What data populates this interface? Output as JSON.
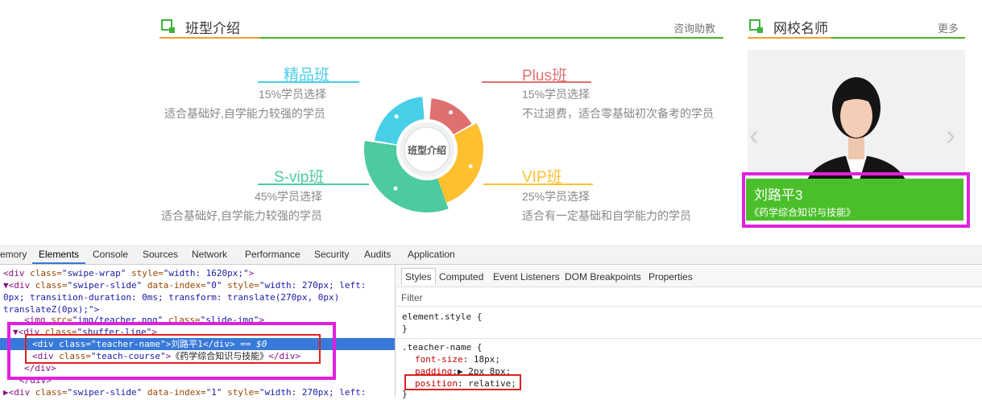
{
  "page": {
    "class_section": {
      "title": "班型介绍",
      "more": "咨询助教",
      "pie_center": "班型介绍",
      "classes": [
        {
          "name": "精品班",
          "ratio": "15%学员选择",
          "desc": "适合基础好,自学能力较强的学员",
          "color": "#48cfe8"
        },
        {
          "name": "Plus班",
          "ratio": "15%学员选择",
          "desc": "不过退费，适合零基础初次备考的学员",
          "color": "#e07070"
        },
        {
          "name": "S-vip班",
          "ratio": "45%学员选择",
          "desc": "适合基础好,自学能力较强的学员",
          "color": "#4ccaa0"
        },
        {
          "name": "VIP班",
          "ratio": "25%学员选择",
          "desc": "适合有一定基础和自学能力的学员",
          "color": "#ffc030"
        }
      ]
    },
    "teacher_section": {
      "title": "网校名师",
      "more": "更多",
      "teacher_name": "刘路平3",
      "teacher_course": "《药学综合知识与技能》",
      "prev_arrow": "‹",
      "next_arrow": "›"
    }
  },
  "devtools": {
    "tabs": [
      "emory",
      "Elements",
      "Console",
      "Sources",
      "Network",
      "Performance",
      "Security",
      "Audits",
      "Application"
    ],
    "active_tab": "Elements",
    "dom_lines": [
      {
        "pre": "<",
        "tag": "div",
        "attr": " class=",
        "val": "\"swipe-wrap\"",
        "attr2": " style=",
        "val2": "\"width: 1620px;\"",
        "post": ">"
      },
      {
        "pre": "▼<",
        "tag": "div",
        "attr": " class=",
        "val": "\"swiper-slide\"",
        "attr2": " data-index=",
        "val2": "\"0\"",
        "attr3": " style=",
        "val3": "\"width: 270px; left:",
        "post": ""
      },
      {
        "text": "0px; transition-duration: 0ms; transform: translate(270px, 0px)"
      },
      {
        "text": "translateZ(0px);\">"
      },
      {
        "pre": "<",
        "tag": "img",
        "attr": " src=",
        "val": "\"img/teacher.png\"",
        "attr2": " class=",
        "val2": "\"slide-img\"",
        "post": ">"
      },
      {
        "pre": "▼<",
        "tag": "div",
        "attr": " class=",
        "val": "\"shuffer-line\"",
        "post": ">"
      },
      {
        "pre": "<",
        "tag": "div",
        "attr": " class=",
        "val": "\"teacher-name\"",
        "post": ">",
        "text": "刘路平1",
        "close": "</div>",
        "extra": " == $0"
      },
      {
        "pre": "<",
        "tag": "div",
        "attr": " class=",
        "val": "\"teach-course\"",
        "post": ">",
        "text": "《药学综合知识与技能》",
        "close": "</div>"
      },
      {
        "close": "</div>"
      },
      {
        "close": "</div>"
      },
      {
        "pre": "▶<",
        "tag": "div",
        "attr": " class=",
        "val": "\"swiper-slide\"",
        "attr2": " data-index=",
        "val2": "\"1\"",
        "attr3": " style=",
        "val3": "\"width: 270px; left:",
        "post": ""
      }
    ],
    "styles_tabs": [
      "Styles",
      "Computed",
      "Event Listeners",
      "DOM Breakpoints",
      "Properties"
    ],
    "filter_label": "Filter",
    "rules": {
      "element_style": "element.style {",
      "element_close": "}",
      "selector": ".teacher-name {",
      "font_size_prop": "font-size",
      "font_size_val": "18px;",
      "padding_prop": "padding",
      "padding_val": "▶ 2px 8px;",
      "position_prop": "position",
      "position_val": "relative;",
      "close": "}"
    },
    "highlight_colors": {
      "magenta": "#e020e0",
      "red": "#e02020",
      "selection": "#3879d9"
    }
  }
}
